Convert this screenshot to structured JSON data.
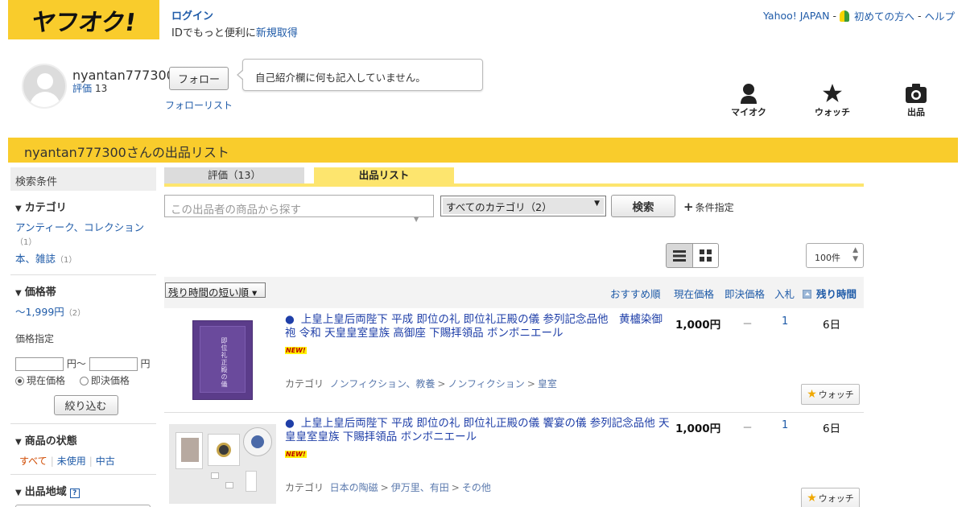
{
  "header": {
    "logo": "ヤフオク!",
    "login": "ログイン",
    "login_note": "IDでもっと便利に",
    "register": "新規取得",
    "links": {
      "yahoo": "Yahoo! JAPAN",
      "beginner": "初めての方へ",
      "help": "ヘルプ",
      "sep": "-"
    }
  },
  "profile": {
    "username": "nyantan777300",
    "rating_label": "評価",
    "rating_count": "13",
    "follow": "フォロー",
    "follow_list": "フォローリスト",
    "bio": "自己紹介欄に何も記入していません。"
  },
  "nav": {
    "myauc": "マイオク",
    "watch": "ウォッチ",
    "sell": "出品"
  },
  "banner": "nyantan777300さんの出品リスト",
  "tabs": {
    "rating": "評価（13）",
    "list": "出品リスト"
  },
  "search": {
    "placeholder": "この出品者の商品から探す",
    "category": "すべてのカテゴリ（2）",
    "button": "検索",
    "conditions": "条件指定"
  },
  "sidebar": {
    "title": "検索条件",
    "category": {
      "title": "カテゴリ",
      "items": [
        {
          "label": "アンティーク、コレクション",
          "count": "（1）"
        },
        {
          "label": "本、雑誌",
          "count": "（1）"
        }
      ]
    },
    "price": {
      "title": "価格帯",
      "range": {
        "label": "〜1,999円",
        "count": "（2）"
      },
      "specify": "価格指定",
      "yen_from": "円～",
      "yen": "円",
      "current": "現在価格",
      "buyout": "即決価格",
      "apply": "絞り込む"
    },
    "condition": {
      "title": "商品の状態",
      "all": "すべて",
      "unused": "未使用",
      "used": "中古"
    },
    "region": {
      "title": "出品地域",
      "help": "?"
    }
  },
  "view": {
    "per_page": "100件"
  },
  "sort": {
    "select": "残り時間の短い順",
    "recommended": "おすすめ順",
    "current_price": "現在価格",
    "buyout": "即決価格",
    "bids": "入札",
    "time_left": "残り時間"
  },
  "items": [
    {
      "title": "上皇上皇后両陛下 平成 即位の礼 即位礼正殿の儀 参列記念品他　黄櫨染御袍 令和 天皇皇室皇族 高御座 下賜拝領品 ボンボニエール",
      "badge": "NEW!",
      "category_label": "カテゴリ",
      "category_path": [
        "ノンフィクション、教養",
        "ノンフィクション",
        "皇室"
      ],
      "price": "1,000円",
      "buyout": "－",
      "bids": "1",
      "time_left": "6日",
      "watch": "ウォッチ",
      "thumb_text": "即位礼正殿の儀"
    },
    {
      "title": "上皇上皇后両陛下 平成 即位の礼 即位礼正殿の儀 饗宴の儀 参列記念品他 天皇皇室皇族 下賜拝領品 ボンボニエール",
      "badge": "NEW!",
      "category_label": "カテゴリ",
      "category_path": [
        "日本の陶磁",
        "伊万里、有田",
        "その他"
      ],
      "price": "1,000円",
      "buyout": "－",
      "bids": "1",
      "time_left": "6日",
      "watch": "ウォッチ"
    }
  ]
}
